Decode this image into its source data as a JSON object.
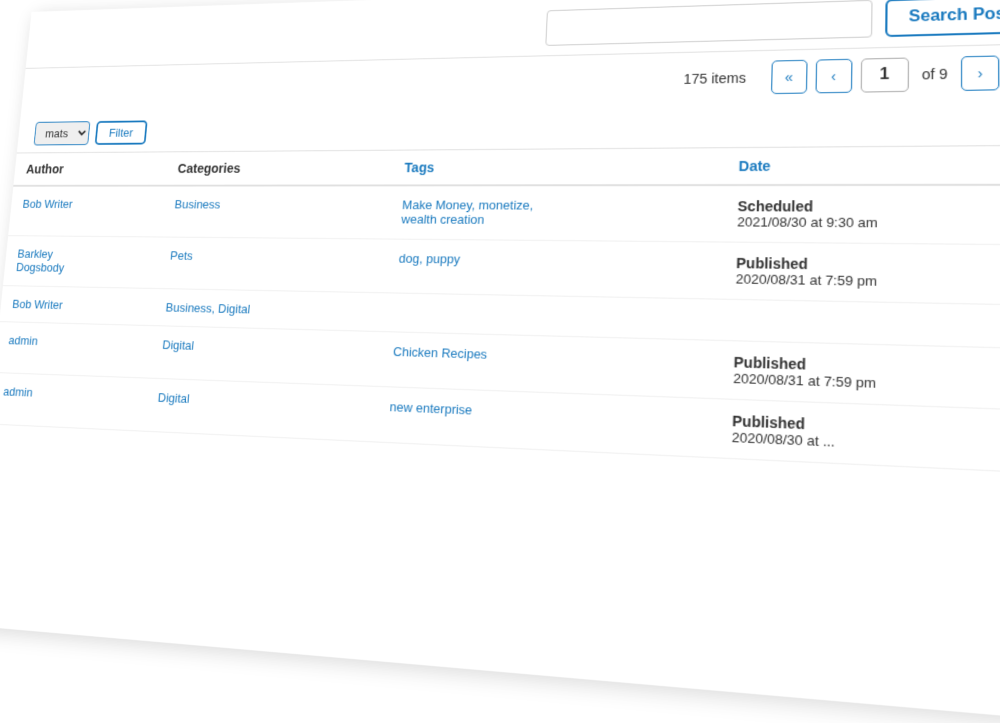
{
  "header": {
    "search_placeholder": "",
    "search_button_label": "Search Posts"
  },
  "pagination": {
    "items_count": "175 items",
    "current_page": "1",
    "of_label": "of 9",
    "prev_first": "«",
    "prev": "‹",
    "next": "›",
    "next_last": "»"
  },
  "filter": {
    "format_label": "mats",
    "filter_button_label": "Filter"
  },
  "table": {
    "columns": {
      "author": "Author",
      "categories": "Categories",
      "tags": "Tags",
      "date": "Date"
    },
    "rows": [
      {
        "author": "Bob Writer",
        "categories": "Business",
        "tags": "Make Money, monetize, wealth creation",
        "date_status": "Scheduled",
        "date_value": "2021/08/30 at 9:30 am"
      },
      {
        "author": "Barkley Dogsbody",
        "categories": "Pets",
        "tags": "dog, puppy",
        "date_status": "Published",
        "date_value": "2020/08/31 at 7:59 pm"
      },
      {
        "author": "Bob Writer",
        "categories": "Business, Digital",
        "tags": "",
        "date_status": "",
        "date_value": ""
      },
      {
        "author": "admin",
        "categories": "Digital",
        "tags": "Chicken Recipes",
        "date_status": "Published",
        "date_value": "2020/08/31 at 7:59 pm"
      },
      {
        "author": "admin",
        "categories": "Digital",
        "tags": "new enterprise",
        "date_status": "Published",
        "date_value": "2020/08/30 at ..."
      }
    ]
  }
}
